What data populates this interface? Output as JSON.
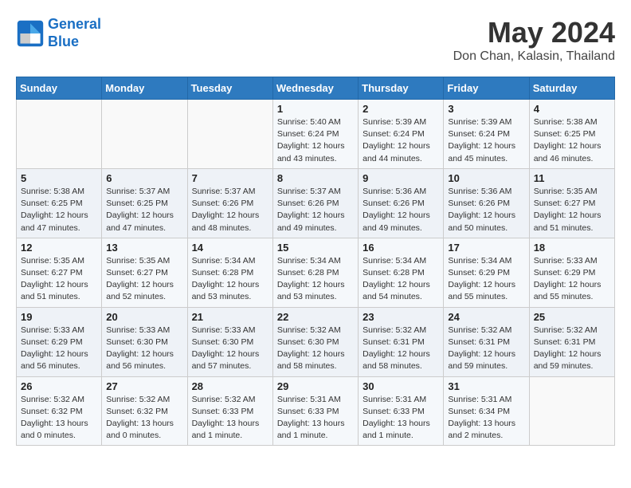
{
  "header": {
    "logo_line1": "General",
    "logo_line2": "Blue",
    "month_year": "May 2024",
    "location": "Don Chan, Kalasin, Thailand"
  },
  "days_of_week": [
    "Sunday",
    "Monday",
    "Tuesday",
    "Wednesday",
    "Thursday",
    "Friday",
    "Saturday"
  ],
  "weeks": [
    [
      {
        "day": "",
        "info": ""
      },
      {
        "day": "",
        "info": ""
      },
      {
        "day": "",
        "info": ""
      },
      {
        "day": "1",
        "info": "Sunrise: 5:40 AM\nSunset: 6:24 PM\nDaylight: 12 hours\nand 43 minutes."
      },
      {
        "day": "2",
        "info": "Sunrise: 5:39 AM\nSunset: 6:24 PM\nDaylight: 12 hours\nand 44 minutes."
      },
      {
        "day": "3",
        "info": "Sunrise: 5:39 AM\nSunset: 6:24 PM\nDaylight: 12 hours\nand 45 minutes."
      },
      {
        "day": "4",
        "info": "Sunrise: 5:38 AM\nSunset: 6:25 PM\nDaylight: 12 hours\nand 46 minutes."
      }
    ],
    [
      {
        "day": "5",
        "info": "Sunrise: 5:38 AM\nSunset: 6:25 PM\nDaylight: 12 hours\nand 47 minutes."
      },
      {
        "day": "6",
        "info": "Sunrise: 5:37 AM\nSunset: 6:25 PM\nDaylight: 12 hours\nand 47 minutes."
      },
      {
        "day": "7",
        "info": "Sunrise: 5:37 AM\nSunset: 6:26 PM\nDaylight: 12 hours\nand 48 minutes."
      },
      {
        "day": "8",
        "info": "Sunrise: 5:37 AM\nSunset: 6:26 PM\nDaylight: 12 hours\nand 49 minutes."
      },
      {
        "day": "9",
        "info": "Sunrise: 5:36 AM\nSunset: 6:26 PM\nDaylight: 12 hours\nand 49 minutes."
      },
      {
        "day": "10",
        "info": "Sunrise: 5:36 AM\nSunset: 6:26 PM\nDaylight: 12 hours\nand 50 minutes."
      },
      {
        "day": "11",
        "info": "Sunrise: 5:35 AM\nSunset: 6:27 PM\nDaylight: 12 hours\nand 51 minutes."
      }
    ],
    [
      {
        "day": "12",
        "info": "Sunrise: 5:35 AM\nSunset: 6:27 PM\nDaylight: 12 hours\nand 51 minutes."
      },
      {
        "day": "13",
        "info": "Sunrise: 5:35 AM\nSunset: 6:27 PM\nDaylight: 12 hours\nand 52 minutes."
      },
      {
        "day": "14",
        "info": "Sunrise: 5:34 AM\nSunset: 6:28 PM\nDaylight: 12 hours\nand 53 minutes."
      },
      {
        "day": "15",
        "info": "Sunrise: 5:34 AM\nSunset: 6:28 PM\nDaylight: 12 hours\nand 53 minutes."
      },
      {
        "day": "16",
        "info": "Sunrise: 5:34 AM\nSunset: 6:28 PM\nDaylight: 12 hours\nand 54 minutes."
      },
      {
        "day": "17",
        "info": "Sunrise: 5:34 AM\nSunset: 6:29 PM\nDaylight: 12 hours\nand 55 minutes."
      },
      {
        "day": "18",
        "info": "Sunrise: 5:33 AM\nSunset: 6:29 PM\nDaylight: 12 hours\nand 55 minutes."
      }
    ],
    [
      {
        "day": "19",
        "info": "Sunrise: 5:33 AM\nSunset: 6:29 PM\nDaylight: 12 hours\nand 56 minutes."
      },
      {
        "day": "20",
        "info": "Sunrise: 5:33 AM\nSunset: 6:30 PM\nDaylight: 12 hours\nand 56 minutes."
      },
      {
        "day": "21",
        "info": "Sunrise: 5:33 AM\nSunset: 6:30 PM\nDaylight: 12 hours\nand 57 minutes."
      },
      {
        "day": "22",
        "info": "Sunrise: 5:32 AM\nSunset: 6:30 PM\nDaylight: 12 hours\nand 58 minutes."
      },
      {
        "day": "23",
        "info": "Sunrise: 5:32 AM\nSunset: 6:31 PM\nDaylight: 12 hours\nand 58 minutes."
      },
      {
        "day": "24",
        "info": "Sunrise: 5:32 AM\nSunset: 6:31 PM\nDaylight: 12 hours\nand 59 minutes."
      },
      {
        "day": "25",
        "info": "Sunrise: 5:32 AM\nSunset: 6:31 PM\nDaylight: 12 hours\nand 59 minutes."
      }
    ],
    [
      {
        "day": "26",
        "info": "Sunrise: 5:32 AM\nSunset: 6:32 PM\nDaylight: 13 hours\nand 0 minutes."
      },
      {
        "day": "27",
        "info": "Sunrise: 5:32 AM\nSunset: 6:32 PM\nDaylight: 13 hours\nand 0 minutes."
      },
      {
        "day": "28",
        "info": "Sunrise: 5:32 AM\nSunset: 6:33 PM\nDaylight: 13 hours\nand 1 minute."
      },
      {
        "day": "29",
        "info": "Sunrise: 5:31 AM\nSunset: 6:33 PM\nDaylight: 13 hours\nand 1 minute."
      },
      {
        "day": "30",
        "info": "Sunrise: 5:31 AM\nSunset: 6:33 PM\nDaylight: 13 hours\nand 1 minute."
      },
      {
        "day": "31",
        "info": "Sunrise: 5:31 AM\nSunset: 6:34 PM\nDaylight: 13 hours\nand 2 minutes."
      },
      {
        "day": "",
        "info": ""
      }
    ]
  ]
}
